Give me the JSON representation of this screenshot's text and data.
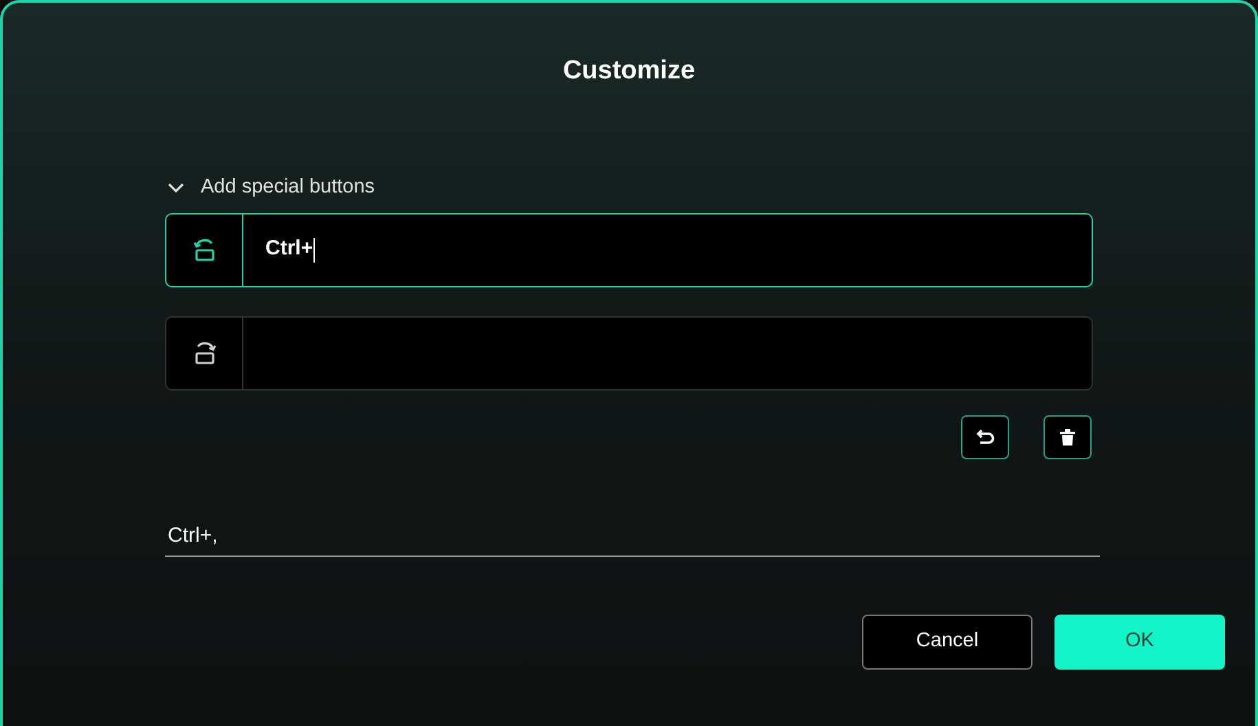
{
  "dialog": {
    "title": "Customize"
  },
  "section": {
    "label": "Add special buttons",
    "expanded": true
  },
  "fields": [
    {
      "kind": "rotate-left",
      "value": "Ctrl+",
      "focused": true
    },
    {
      "kind": "rotate-right",
      "focused": false
    }
  ],
  "actions": [
    {
      "kind": "undo"
    },
    {
      "kind": "delete"
    }
  ],
  "result": {
    "value": "Ctrl+,"
  },
  "buttons": [
    {
      "label": "Cancel",
      "kind": "secondary"
    },
    {
      "label": "OK",
      "kind": "primary"
    }
  ]
}
